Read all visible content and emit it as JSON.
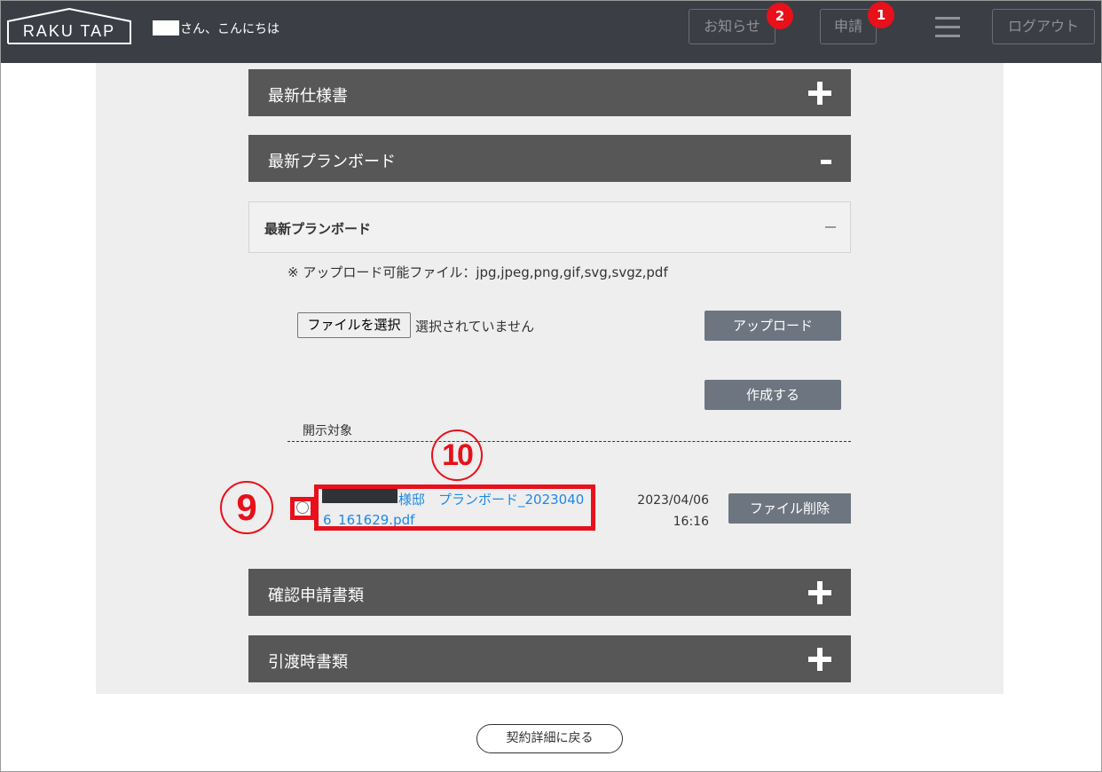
{
  "header": {
    "logo_text": "RAKU TAP",
    "greeting": "さん、こんにちは",
    "notice_label": "お知らせ",
    "notice_count": "2",
    "apply_label": "申請",
    "apply_count": "1",
    "logout_label": "ログアウト"
  },
  "sections": {
    "spec": {
      "title": "最新仕様書"
    },
    "planboard": {
      "title": "最新プランボード"
    },
    "confirm": {
      "title": "確認申請書類"
    },
    "handover": {
      "title": "引渡時書類"
    }
  },
  "planboard_panel": {
    "sub_title": "最新プランボード",
    "note": "※ アップロード可能ファイル：jpg,jpeg,png,gif,svg,svgz,pdf",
    "file_button": "ファイルを選択",
    "file_status": "選択されていません",
    "upload_button": "アップロード",
    "create_button": "作成する",
    "target_label": "開示対象",
    "files": [
      {
        "name": "様邸　プランボード_20230406_161629.pdf",
        "date": "2023/04/06",
        "time": "16:16",
        "delete_label": "ファイル削除"
      }
    ]
  },
  "annotations": {
    "nine": "9",
    "ten": "10"
  },
  "footer": {
    "back_button": "契約詳細に戻る"
  },
  "colors": {
    "header_bg": "#3b3e45",
    "accordion_bg": "#575757",
    "button_gray": "#6d7680",
    "badge_red": "#e8101a",
    "link_blue": "#1e88e5"
  }
}
